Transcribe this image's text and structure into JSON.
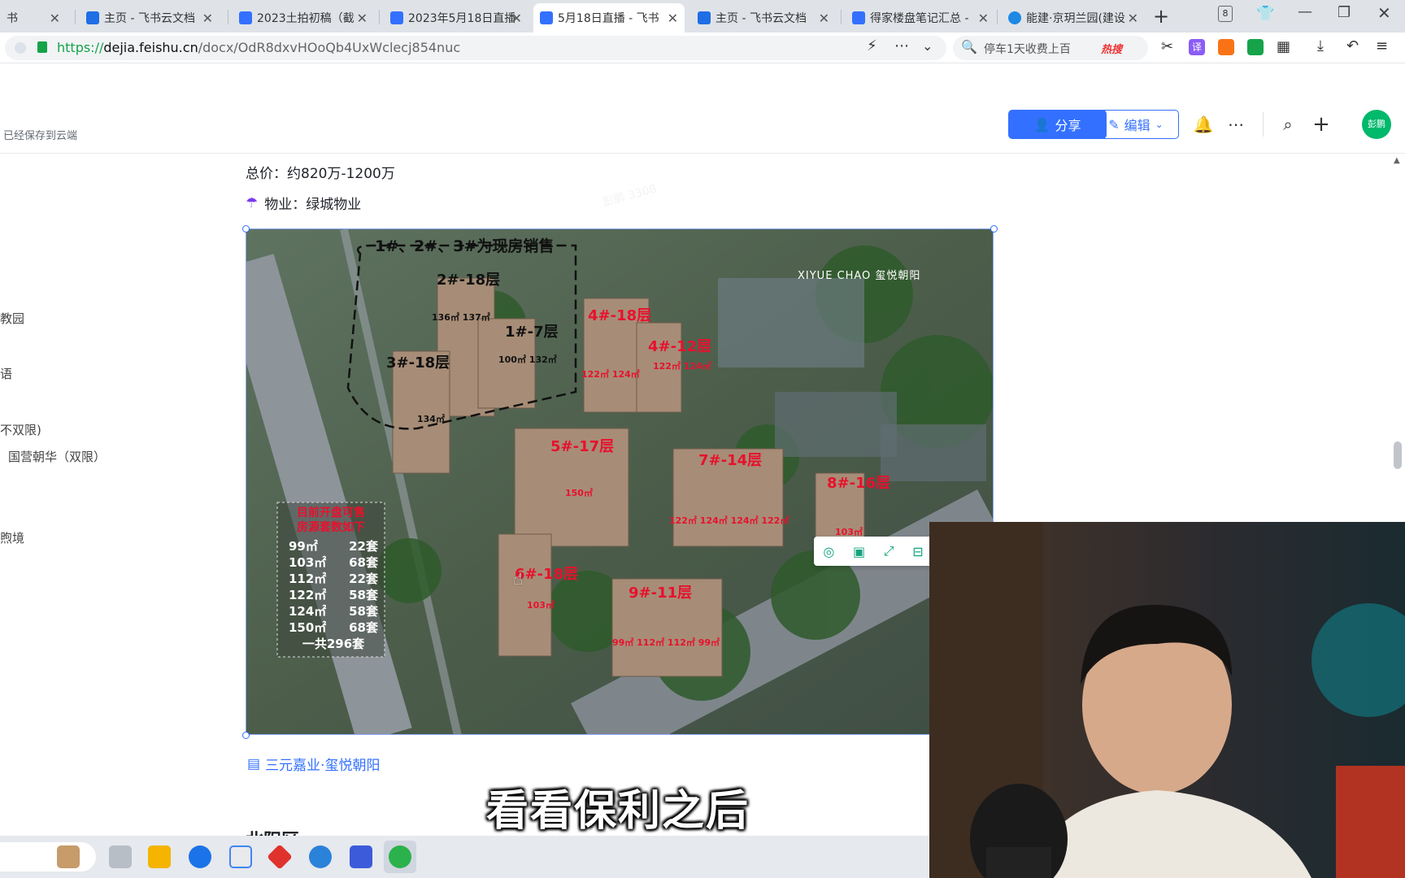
{
  "browser": {
    "tabs": [
      {
        "title": "书",
        "active": false,
        "fav": "#1f5fe6"
      },
      {
        "title": "主页 - 飞书云文档",
        "active": false,
        "fav": "#1f6ee6"
      },
      {
        "title": "2023土拍初稿（截",
        "active": false,
        "fav": "#3370ff"
      },
      {
        "title": "2023年5月18日直播",
        "active": false,
        "fav": "#3370ff"
      },
      {
        "title": "5月18日直播 - 飞书",
        "active": true,
        "fav": "#3370ff"
      },
      {
        "title": "主页 - 飞书云文档",
        "active": false,
        "fav": "#1f6ee6"
      },
      {
        "title": "得家楼盘笔记汇总 -",
        "active": false,
        "fav": "#3370ff"
      },
      {
        "title": "能建·京玥兰园(建设",
        "active": false,
        "fav": "#1e88e5"
      }
    ],
    "new_tab_label": "+",
    "tab_count_badge": "8",
    "url_scheme": "https://",
    "url_host": "dejia.feishu.cn",
    "url_path": "/docx/OdR8dxvHOoQb4UxWclecj854nuc",
    "search_placeholder": "停车1天收费上百",
    "hot_search_label": "热搜"
  },
  "doc": {
    "save_status": "已经保存到云端",
    "share_label": "分享",
    "edit_label": "编辑",
    "avatar_text": "彭鹏",
    "watermark_text": "彭鹏 3308",
    "price_line": "总价：约820万-1200万",
    "property_line": "物业：绿城物业",
    "image_caption_link": "三元嘉业·玺悦朝阳",
    "next_heading_partial": "北阳区"
  },
  "sidebar": {
    "items": [
      "教园",
      "语",
      "不双限)",
      "国营朝华（双限）",
      "煦境"
    ]
  },
  "image": {
    "top_banner": "1#、2#、3#为现房销售",
    "brand": "XIYUE CHAO 玺悦朝阳",
    "buildings": [
      {
        "label": "2#-18层",
        "units": "136㎡   137㎡"
      },
      {
        "label": "1#-7层",
        "units": "100㎡   132㎡"
      },
      {
        "label": "3#-18层",
        "units": "134㎡"
      },
      {
        "label": "4#-18层",
        "units": "122㎡   124㎡"
      },
      {
        "label": "4#-12层",
        "units": "122㎡   124㎡"
      },
      {
        "label": "5#-17层",
        "units": "150㎡"
      },
      {
        "label": "7#-14层",
        "units": "122㎡  124㎡  124㎡  122㎡"
      },
      {
        "label": "8#-16层",
        "units": "103㎡"
      },
      {
        "label": "6#-18层",
        "units": "103㎡"
      },
      {
        "label": "9#-11层",
        "units": "99㎡  112㎡  112㎡  99㎡"
      }
    ],
    "sale_box_title": "目前开盘可售",
    "sale_box_subtitle": "房源套数如下",
    "sale_rows": [
      {
        "area": "99㎡",
        "count": "22套"
      },
      {
        "area": "103㎡",
        "count": "68套"
      },
      {
        "area": "112㎡",
        "count": "22套"
      },
      {
        "area": "122㎡",
        "count": "58套"
      },
      {
        "area": "124㎡",
        "count": "58套"
      },
      {
        "area": "150㎡",
        "count": "68套"
      }
    ],
    "sale_total": "一共296套"
  },
  "subtitle": "看看保利之后",
  "colors": {
    "accent": "#3370ff",
    "avatar": "#00b96b",
    "building_label": "#e8112d",
    "tabbar": "#dfe3e8"
  }
}
